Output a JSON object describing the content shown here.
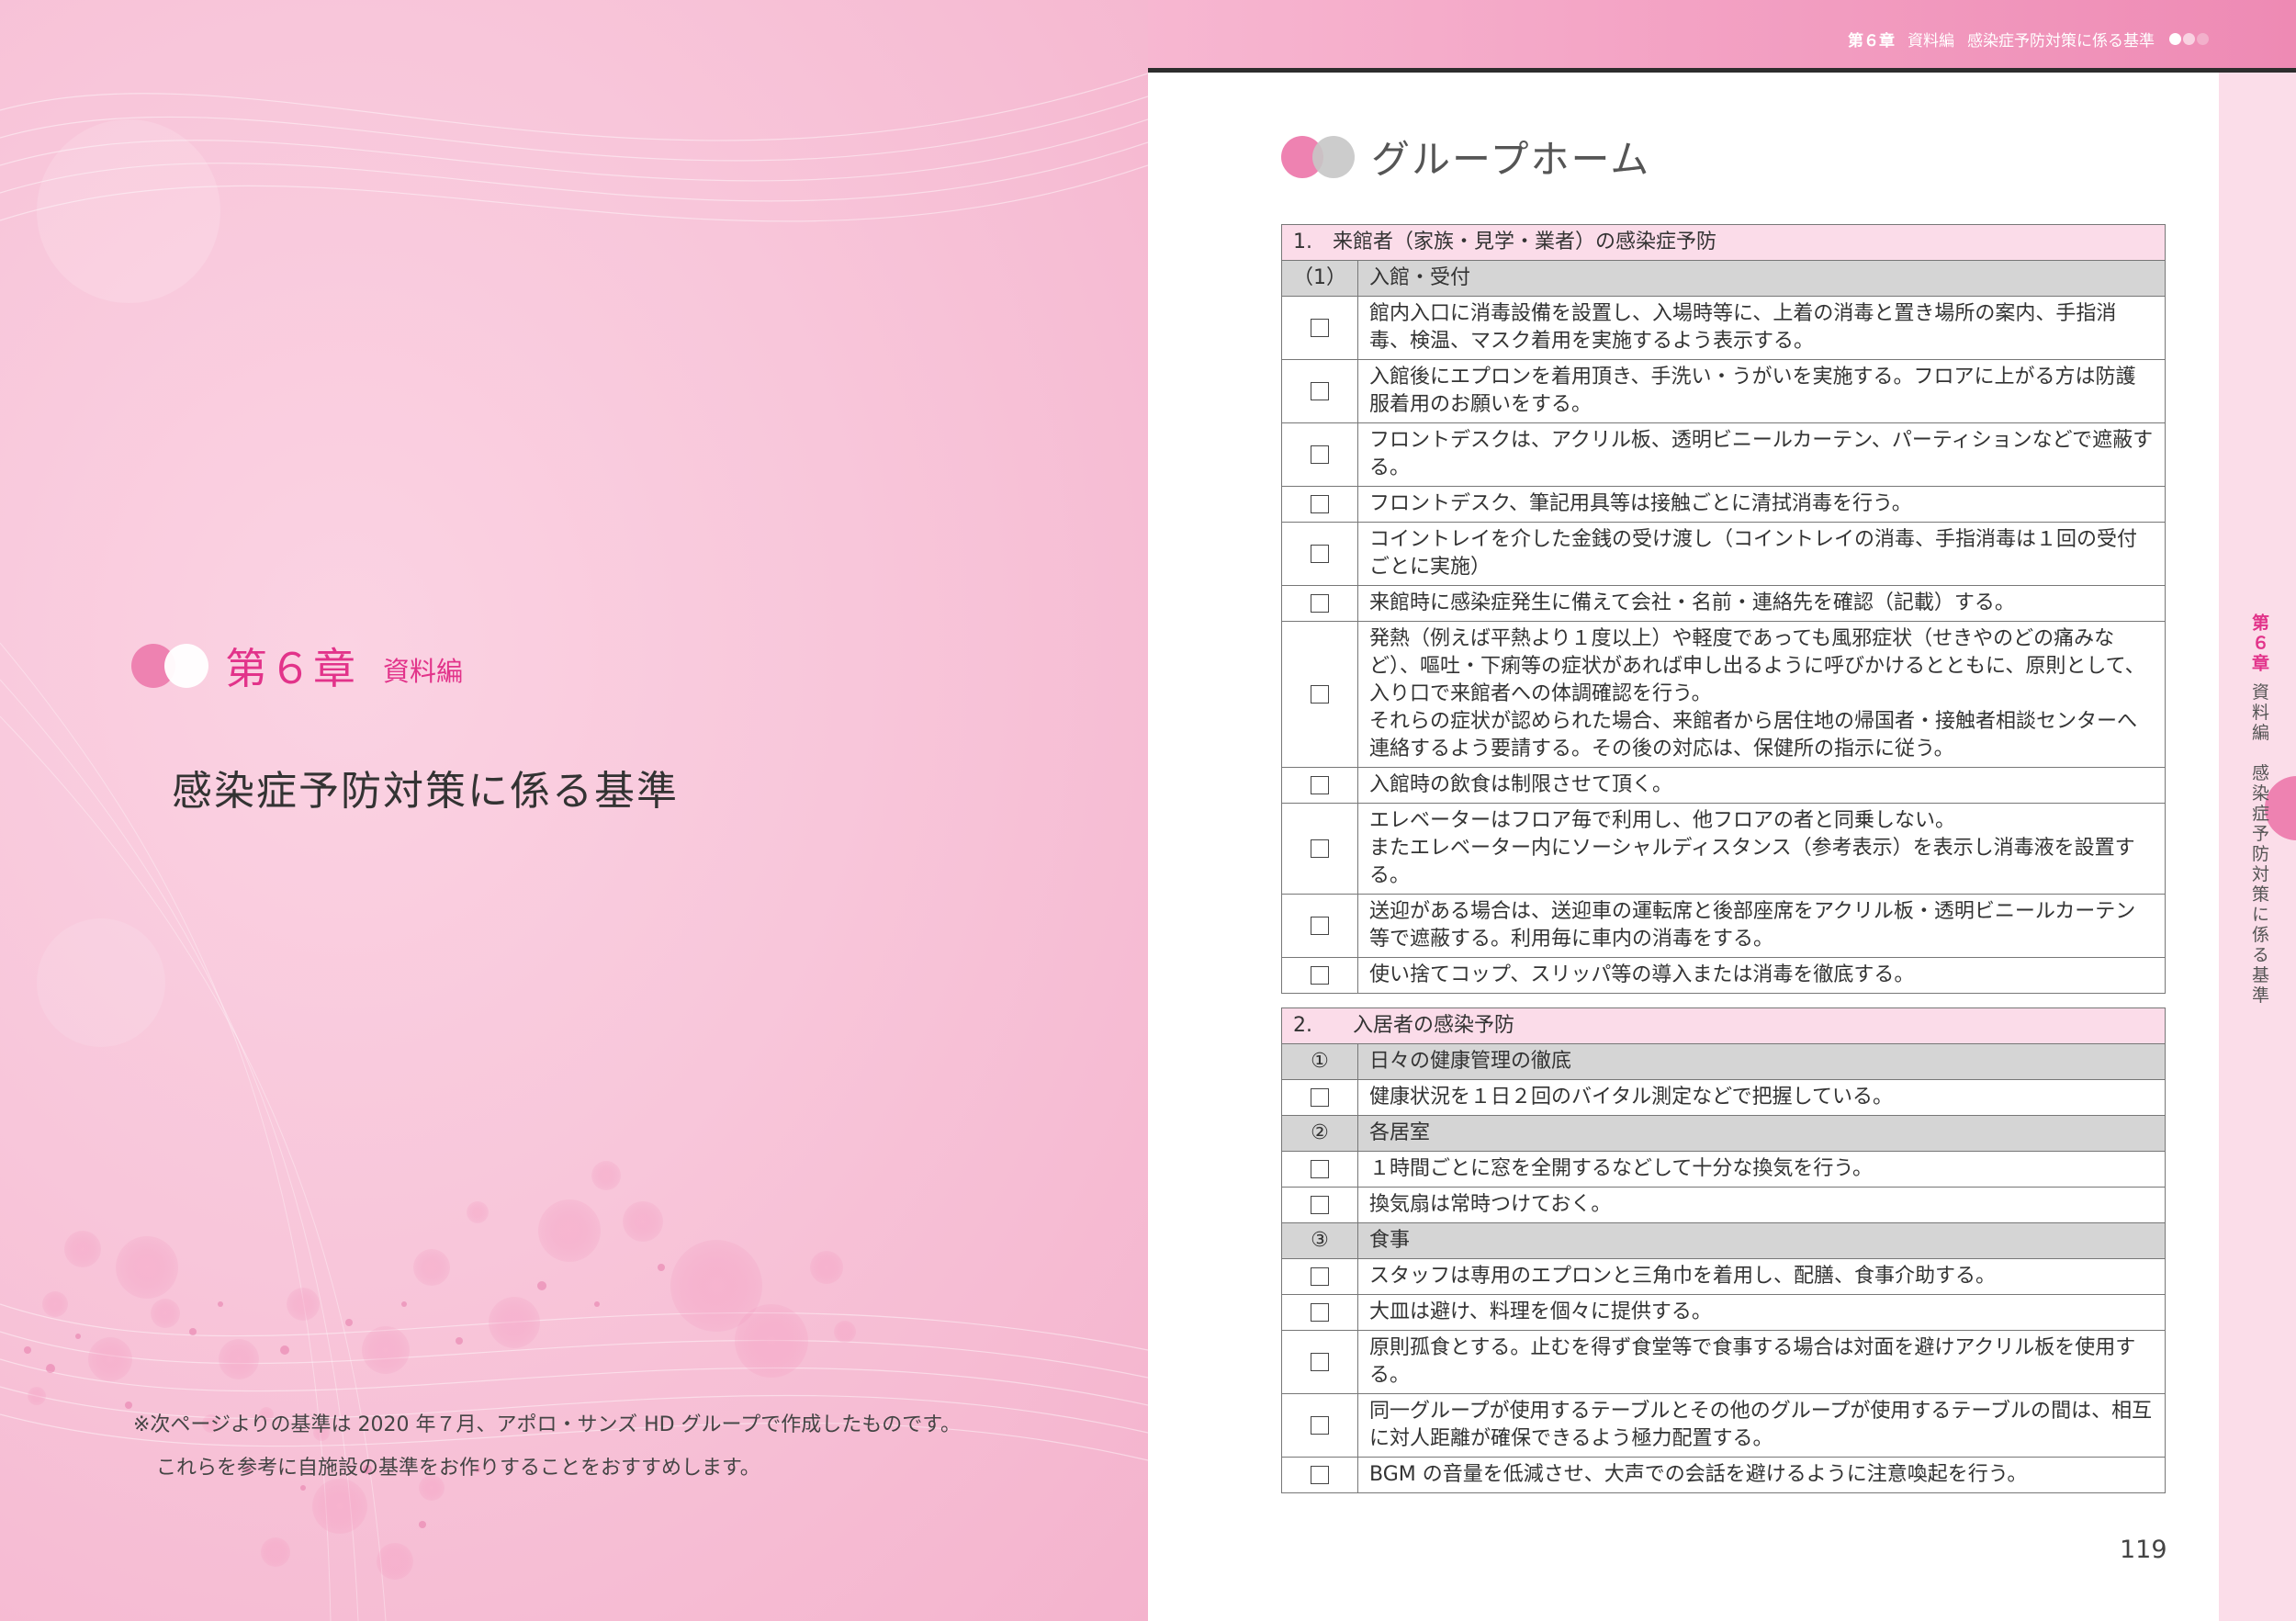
{
  "left": {
    "chapter_number": "第６章",
    "chapter_label": "資料編",
    "title": "感染症予防対策に係る基準",
    "note_line1": "※次ページよりの基準は 2020 年７月、アポロ・サンズ HD グループで作成したものです。",
    "note_line2": "これらを参考に自施設の基準をお作りすることをおすすめします。"
  },
  "header": {
    "chapter": "第６章",
    "section": "資料編",
    "topic": "感染症予防対策に係る基準",
    "dot_colors": [
      "#ffffff",
      "#f9d2e2",
      "#f2b0cb"
    ]
  },
  "side_tab": {
    "chapter": "第６章",
    "text": "資料編　感染症予防対策に係る基準"
  },
  "section_title": "グループホーム",
  "checkbox_glyph": "☐",
  "table1": {
    "heading": "1.　来館者（家族・見学・業者）の感染症予防",
    "sub_marker": "（1）",
    "sub_label": "入館・受付",
    "items": [
      "館内入口に消毒設備を設置し、入場時等に、上着の消毒と置き場所の案内、手指消毒、検温、マスク着用を実施するよう表示する。",
      "入館後にエプロンを着用頂き、手洗い・うがいを実施する。フロアに上がる方は防護服着用のお願いをする。",
      "フロントデスクは、アクリル板、透明ビニールカーテン、パーティションなどで遮蔽する。",
      "フロントデスク、筆記用具等は接触ごとに清拭消毒を行う。",
      "コイントレイを介した金銭の受け渡し（コイントレイの消毒、手指消毒は１回の受付ごとに実施）",
      "来館時に感染症発生に備えて会社・名前・連絡先を確認（記載）する。",
      "発熱（例えば平熱より１度以上）や軽度であっても風邪症状（せきやのどの痛みなど）、嘔吐・下痢等の症状があれば申し出るように呼びかけるとともに、原則として、入り口で来館者への体調確認を行う。\nそれらの症状が認められた場合、来館者から居住地の帰国者・接触者相談センターへ連絡するよう要請する。その後の対応は、保健所の指示に従う。",
      "入館時の飲食は制限させて頂く。",
      "エレベーターはフロア毎で利用し、他フロアの者と同乗しない。\nまたエレベーター内にソーシャルディスタンス（参考表示）を表示し消毒液を設置する。",
      "送迎がある場合は、送迎車の運転席と後部座席をアクリル板・透明ビニールカーテン等で遮蔽する。利用毎に車内の消毒をする。",
      "使い捨てコップ、スリッパ等の導入または消毒を徹底する。"
    ]
  },
  "table2": {
    "heading": "2.　　入居者の感染予防",
    "groups": [
      {
        "marker": "①",
        "label": "日々の健康管理の徹底",
        "items": [
          "健康状況を１日２回のバイタル測定などで把握している。"
        ]
      },
      {
        "marker": "②",
        "label": "各居室",
        "items": [
          "１時間ごとに窓を全開するなどして十分な換気を行う。",
          "換気扇は常時つけておく。"
        ]
      },
      {
        "marker": "③",
        "label": "食事",
        "items": [
          "スタッフは専用のエプロンと三角巾を着用し、配膳、食事介助する。",
          "大皿は避け、料理を個々に提供する。",
          "原則孤食とする。止むを得ず食堂等で食事する場合は対面を避けアクリル板を使用する。",
          "同一グループが使用するテーブルとその他のグループが使用するテーブルの間は、相互に対人距離が確保できるよう極力配置する。",
          "BGM の音量を低減させ、大声での会話を避けるように注意喚起を行う。"
        ]
      }
    ]
  },
  "page_number": "119",
  "colors": {
    "accent": "#e2338a",
    "pink": "#ee82b1",
    "section_bg": "#fbdce9",
    "sub_bg": "#d5d5d5"
  }
}
